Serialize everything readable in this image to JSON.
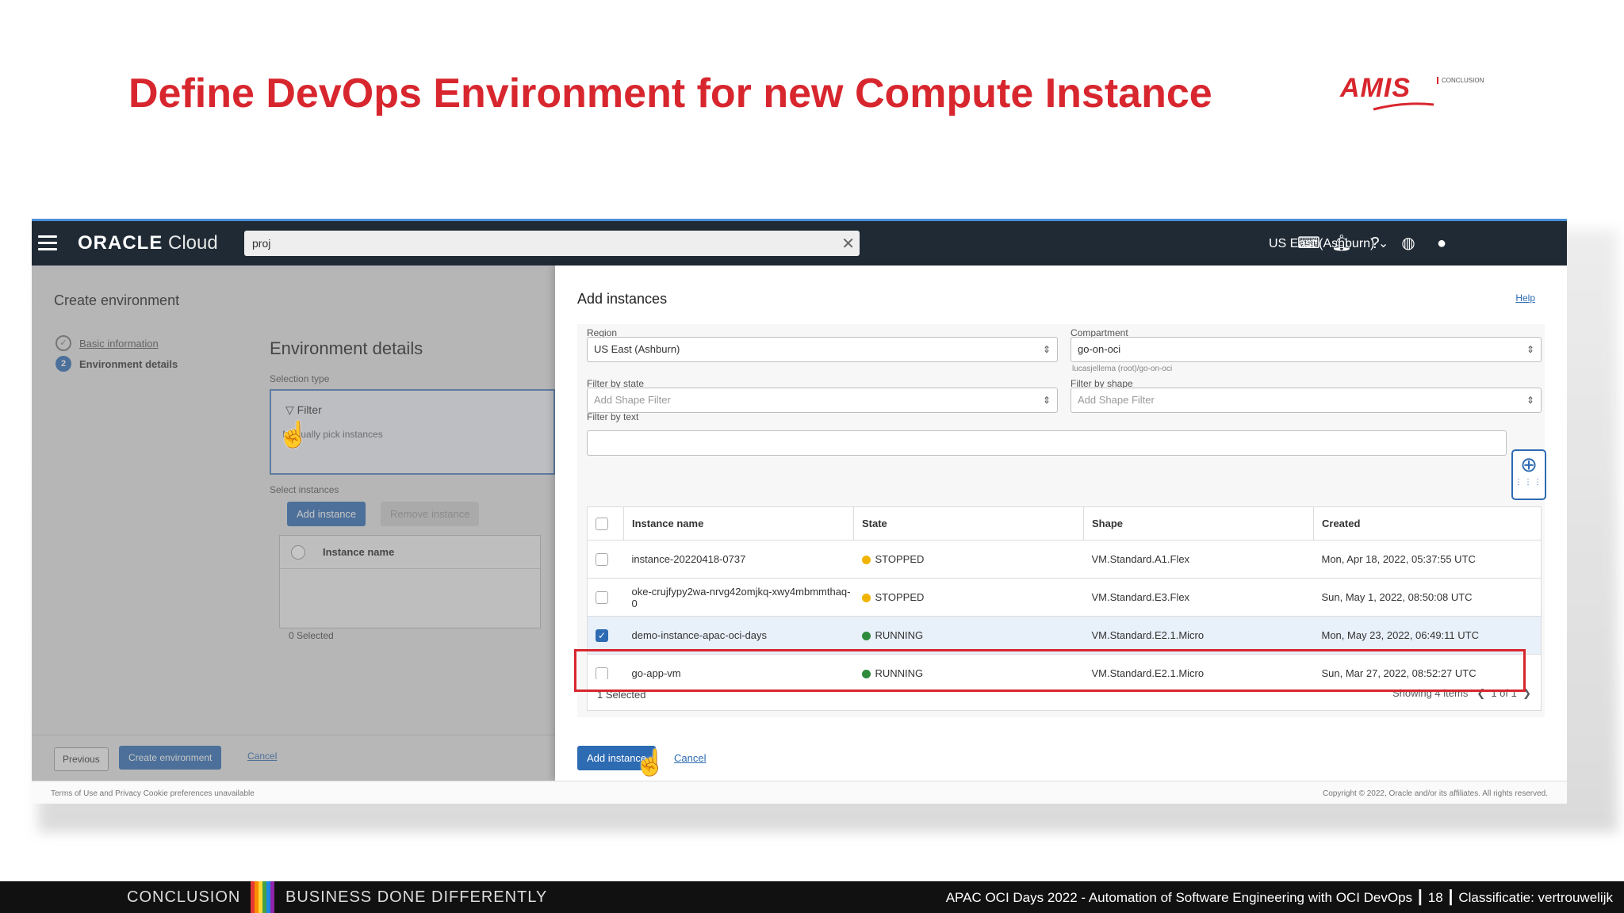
{
  "slide": {
    "title": "Define DevOps Environment for new Compute Instance",
    "logo": "AMIS",
    "logo_sub": "CONCLUSION",
    "footer_left": "CONCLUSION",
    "footer_tagline": "BUSINESS DONE DIFFERENTLY",
    "footer_event": "APAC OCI Days 2022 - Automation of Software Engineering with OCI DevOps",
    "footer_page": "18",
    "footer_class": "Classificatie: vertrouwelijk",
    "stripe_colors": [
      "#e53935",
      "#fb8c00",
      "#fdd835",
      "#43a047",
      "#1e88e5",
      "#8e24aa"
    ]
  },
  "oci": {
    "brand_bold": "ORACLE",
    "brand_light": "Cloud",
    "search_value": "proj",
    "region": "US East (Ashburn)",
    "icons": [
      "terminal-icon",
      "bell-icon",
      "help-icon",
      "globe-icon",
      "user-icon"
    ]
  },
  "left": {
    "title": "Create environment",
    "steps": [
      {
        "num": "✓",
        "label": "Basic information"
      },
      {
        "num": "2",
        "label": "Environment details"
      }
    ],
    "env_title": "Environment details",
    "selection_type_label": "Selection type",
    "filter_title": "Filter",
    "filter_desc": "Manually pick instances",
    "select_instances_label": "Select instances",
    "add_instance": "Add instance",
    "remove_instance": "Remove instance",
    "table_header": "Instance name",
    "selected": "0 Selected",
    "previous": "Previous",
    "create": "Create environment",
    "cancel": "Cancel"
  },
  "right": {
    "title": "Add instances",
    "help": "Help",
    "region_label": "Region",
    "region_value": "US East (Ashburn)",
    "compartment_label": "Compartment",
    "compartment_value": "go-on-oci",
    "compartment_note": "lucasjellema (root)/go-on-oci",
    "filter_state_label": "Filter by state",
    "filter_state_ph": "Add Shape Filter",
    "filter_shape_label": "Filter by shape",
    "filter_shape_ph": "Add Shape Filter",
    "filter_text_label": "Filter by text",
    "columns": [
      "Instance name",
      "State",
      "Shape",
      "Created"
    ],
    "rows": [
      {
        "name": "instance-20220418-0737",
        "state": "STOPPED",
        "shape": "VM.Standard.A1.Flex",
        "created": "Mon, Apr 18, 2022, 05:37:55 UTC",
        "checked": false
      },
      {
        "name": "oke-crujfypy2wa-nrvg42omjkq-xwy4mbmmthaq-0",
        "state": "STOPPED",
        "shape": "VM.Standard.E3.Flex",
        "created": "Sun, May 1, 2022, 08:50:08 UTC",
        "checked": false
      },
      {
        "name": "demo-instance-apac-oci-days",
        "state": "RUNNING",
        "shape": "VM.Standard.E2.1.Micro",
        "created": "Mon, May 23, 2022, 06:49:11 UTC",
        "checked": true
      },
      {
        "name": "go-app-vm",
        "state": "RUNNING",
        "shape": "VM.Standard.E2.1.Micro",
        "created": "Sun, Mar 27, 2022, 08:52:27 UTC",
        "checked": false
      }
    ],
    "state_colors": {
      "STOPPED": "#f0b400",
      "RUNNING": "#2e8b3c"
    },
    "selected": "1 Selected",
    "showing": "Showing 4 items",
    "pager": "1 of 1",
    "add_instance": "Add instance",
    "cancel": "Cancel"
  },
  "page_footer": {
    "left": "Terms of Use and Privacy    Cookie preferences unavailable",
    "right": "Copyright © 2022, Oracle and/or its affiliates. All rights reserved."
  }
}
